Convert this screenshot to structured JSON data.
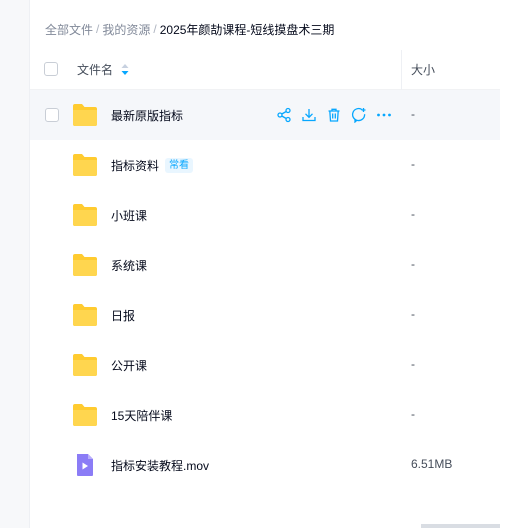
{
  "breadcrumb": {
    "items": [
      "全部文件",
      "我的资源",
      "2025年颜劼课程-短线摸盘术三期"
    ],
    "separator": "/"
  },
  "table": {
    "header_name": "文件名",
    "header_size": "大小"
  },
  "rows": [
    {
      "name": "最新原版指标",
      "size": "-",
      "type": "folder",
      "badge": ""
    },
    {
      "name": "指标资料",
      "size": "-",
      "type": "folder",
      "badge": "常看"
    },
    {
      "name": "小班课",
      "size": "-",
      "type": "folder",
      "badge": ""
    },
    {
      "name": "系统课",
      "size": "-",
      "type": "folder",
      "badge": ""
    },
    {
      "name": "日报",
      "size": "-",
      "type": "folder",
      "badge": ""
    },
    {
      "name": "公开课",
      "size": "-",
      "type": "folder",
      "badge": ""
    },
    {
      "name": "15天陪伴课",
      "size": "-",
      "type": "folder",
      "badge": ""
    },
    {
      "name": "指标安装教程.mov",
      "size": "6.51MB",
      "type": "video",
      "badge": ""
    }
  ],
  "row_actions": [
    "share-icon",
    "download-icon",
    "delete-icon",
    "comment-icon",
    "more-icon"
  ],
  "colors": {
    "accent": "#06a7ff",
    "folder": "#ffcb2f",
    "video": "#8b7cf6",
    "text_primary": "#03081a",
    "text_secondary": "#818999"
  }
}
